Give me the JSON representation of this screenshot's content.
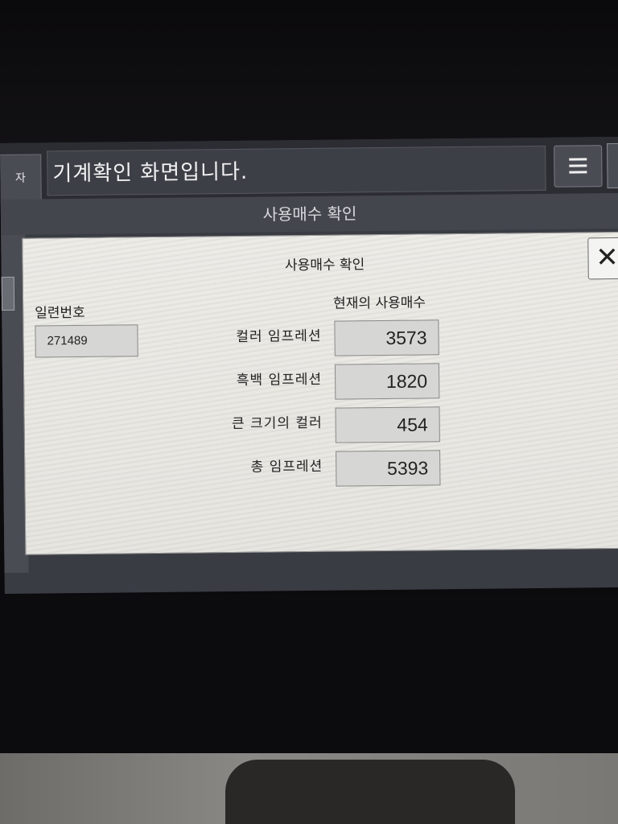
{
  "header": {
    "left_tab_label": "자",
    "message": "기계확인 화면입니다.",
    "subtitle": "사용매수 확인"
  },
  "dialog": {
    "title": "사용매수 확인",
    "close_label": "✕",
    "serial_label": "일련번호",
    "serial_value": "271489",
    "current_header": "현재의 사용매수",
    "counters": [
      {
        "label": "컬러 임프레션",
        "value": "3573"
      },
      {
        "label": "흑백 임프레션",
        "value": "1820"
      },
      {
        "label": "큰 크기의 컬러",
        "value": "454"
      },
      {
        "label": "총 임프레션",
        "value": "5393"
      }
    ]
  },
  "icons": {
    "menu": "hamburger-menu-icon",
    "close": "close-icon"
  }
}
